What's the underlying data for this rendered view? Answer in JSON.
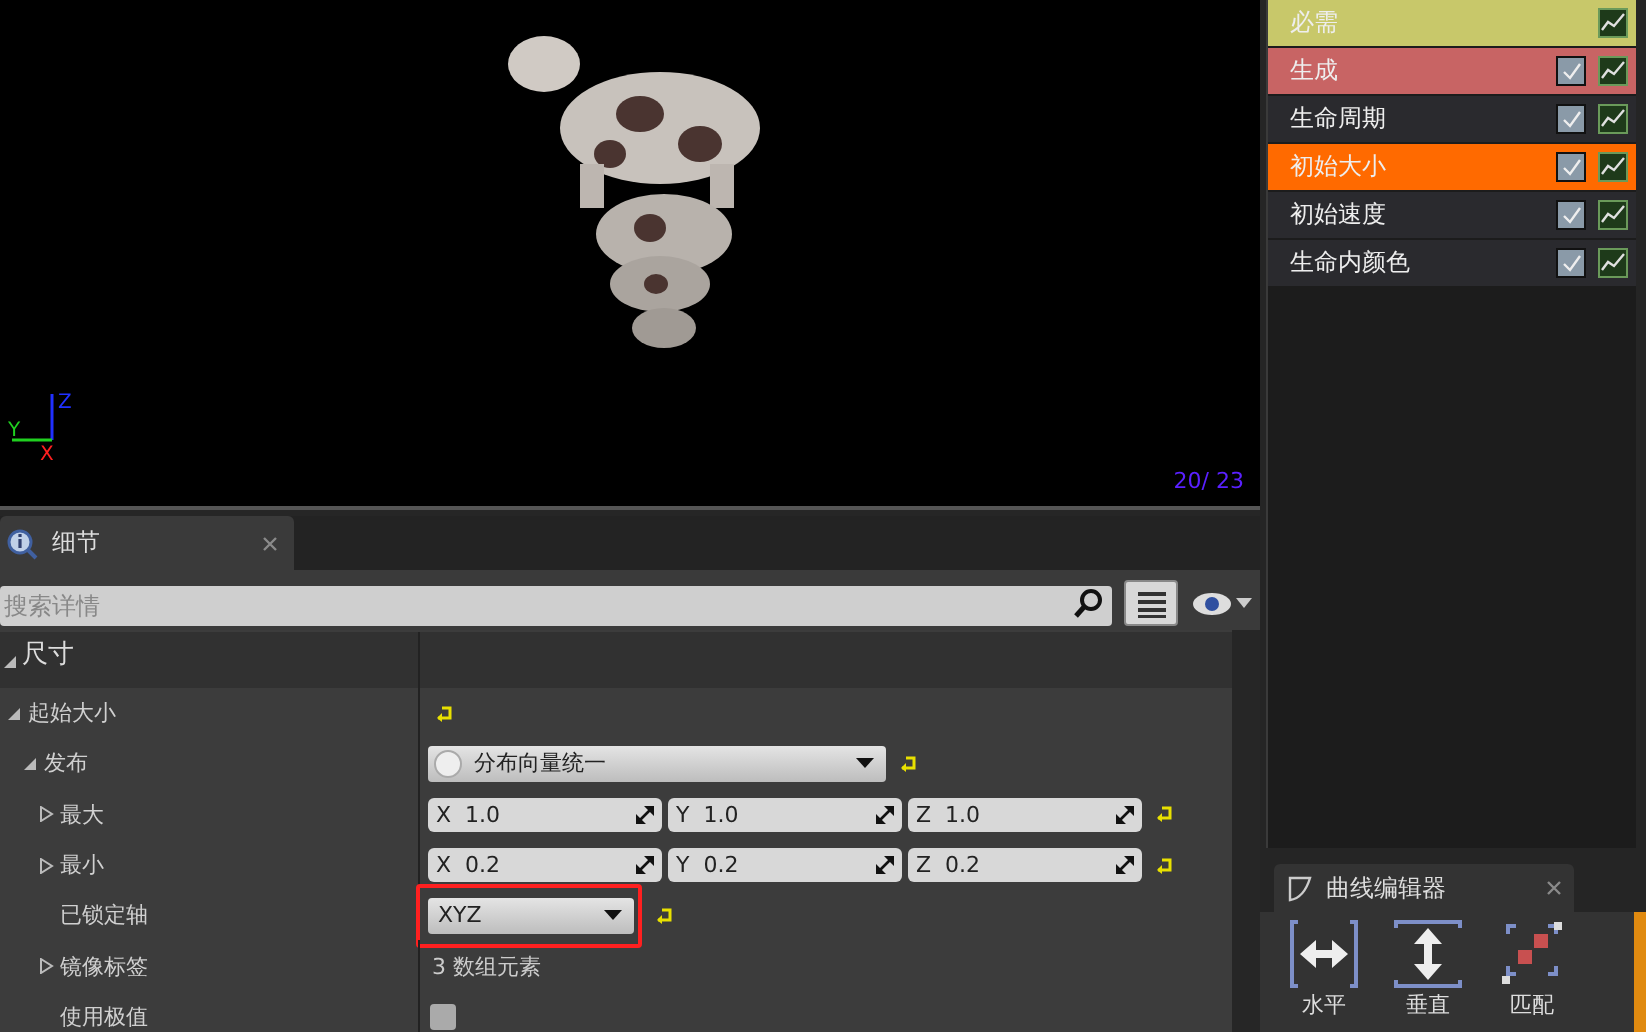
{
  "viewport": {
    "frame_counter": "20/ 23",
    "axes": [
      {
        "axis": "Z"
      },
      {
        "axis": "Y"
      },
      {
        "axis": "X"
      }
    ]
  },
  "details_tab": {
    "title": "细节",
    "selected": true
  },
  "search": {
    "placeholder": "搜索详情"
  },
  "section": {
    "title": "尺寸",
    "expanded": true
  },
  "properties": [
    {
      "label": "起始大小",
      "kind": "group",
      "expanded": true,
      "children": [
        {
          "label": "发布",
          "kind": "dropdown",
          "expanded": true,
          "value": "分布向量统一",
          "children": [
            {
              "label": "最大",
              "kind": "vector",
              "expanded": false,
              "components": [
                {
                  "axis": "X",
                  "value": "1.0"
                },
                {
                  "axis": "Y",
                  "value": "1.0"
                },
                {
                  "axis": "Z",
                  "value": "1.0"
                }
              ]
            },
            {
              "label": "最小",
              "kind": "vector",
              "expanded": false,
              "components": [
                {
                  "axis": "X",
                  "value": "0.2"
                },
                {
                  "axis": "Y",
                  "value": "0.2"
                },
                {
                  "axis": "Z",
                  "value": "0.2"
                }
              ]
            },
            {
              "label": "已锁定轴",
              "kind": "combo",
              "value": "XYZ",
              "highlighted": true
            },
            {
              "label": "镜像标签",
              "kind": "text",
              "expanded": false,
              "value": "3 数组元素"
            },
            {
              "label": "使用极值",
              "kind": "checkbox",
              "checked": false
            }
          ]
        }
      ]
    }
  ],
  "modules": [
    {
      "name": "必需",
      "kind": "required",
      "color": "#c8c86a"
    },
    {
      "name": "生成",
      "kind": "module",
      "color": "#c86464",
      "checked": true
    },
    {
      "name": "生命周期",
      "kind": "module",
      "color": "#2a2a2e",
      "checked": true
    },
    {
      "name": "初始大小",
      "kind": "module",
      "color": "#ff6a00",
      "checked": true
    },
    {
      "name": "初始速度",
      "kind": "module",
      "color": "#2a2a2e",
      "checked": true
    },
    {
      "name": "生命内颜色",
      "kind": "module",
      "color": "#2a2a2e",
      "checked": true
    }
  ],
  "curve_editor": {
    "title": "曲线编辑器",
    "buttons": [
      {
        "label": "水平",
        "kind": "horizontal"
      },
      {
        "label": "垂直",
        "kind": "vertical"
      },
      {
        "label": "匹配",
        "kind": "fit"
      }
    ]
  }
}
